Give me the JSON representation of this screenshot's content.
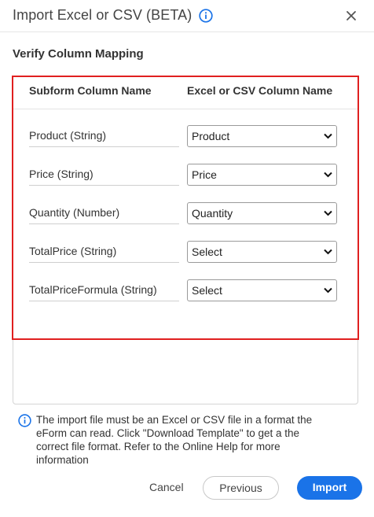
{
  "dialog": {
    "title": "Import Excel or CSV (BETA)",
    "subtitle": "Verify Column Mapping"
  },
  "mapping": {
    "headers": {
      "subform": "Subform Column Name",
      "excel": "Excel or CSV Column Name"
    },
    "rows": [
      {
        "label": "Product (String)",
        "selected": "Product"
      },
      {
        "label": "Price (String)",
        "selected": "Price"
      },
      {
        "label": "Quantity (Number)",
        "selected": "Quantity"
      },
      {
        "label": "TotalPrice (String)",
        "selected": "Select"
      },
      {
        "label": "TotalPriceFormula (String)",
        "selected": "Select"
      }
    ]
  },
  "note": "The import file must be an Excel or CSV file in a format the eForm can read. Click \"Download Template\" to get a the correct file format. Refer to the Online Help for more information",
  "buttons": {
    "cancel": "Cancel",
    "previous": "Previous",
    "import": "Import"
  },
  "colors": {
    "accent": "#1a73e8",
    "highlight_border": "#e02020"
  },
  "icons": {
    "header_info": "info-circle-icon",
    "close": "close-icon",
    "note_info": "info-circle-icon",
    "dropdown": "chevron-down-icon"
  }
}
